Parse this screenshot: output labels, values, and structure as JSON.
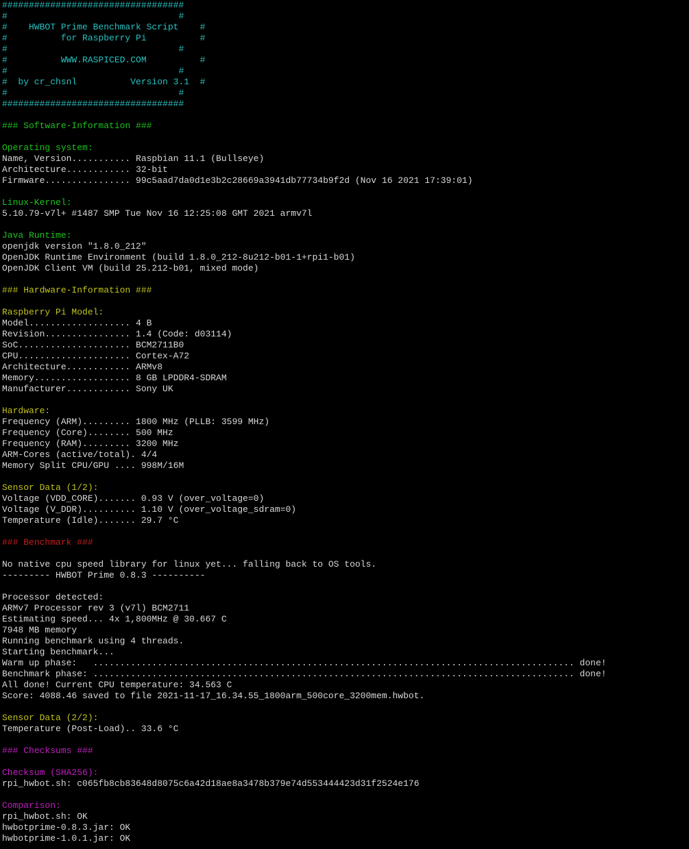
{
  "colors": {
    "background": "#000000",
    "white": "#d8d8d8",
    "cyan": "#29c1c1",
    "green": "#1ec21e",
    "yellow": "#c2c21e",
    "red": "#c41e1e",
    "magenta": "#c21ec2"
  },
  "lines": [
    {
      "text": "##################################",
      "color": "cyan"
    },
    {
      "text": "#                                #",
      "color": "cyan"
    },
    {
      "text": "#    HWBOT Prime Benchmark Script    #",
      "color": "cyan"
    },
    {
      "text": "#          for Raspberry Pi          #",
      "color": "cyan"
    },
    {
      "text": "#                                #",
      "color": "cyan"
    },
    {
      "text": "#          WWW.RASPICED.COM          #",
      "color": "cyan"
    },
    {
      "text": "#                                #",
      "color": "cyan"
    },
    {
      "text": "#  by cr_chsnl          Version 3.1  #",
      "color": "cyan"
    },
    {
      "text": "#                                #",
      "color": "cyan"
    },
    {
      "text": "##################################",
      "color": "cyan"
    },
    {
      "text": "",
      "color": "white"
    },
    {
      "text": "### Software-Information ###",
      "color": "green"
    },
    {
      "text": "",
      "color": "white"
    },
    {
      "text": "Operating system:",
      "color": "green"
    },
    {
      "text": "Name, Version........... Raspbian 11.1 (Bullseye)",
      "color": "white"
    },
    {
      "text": "Architecture............ 32-bit",
      "color": "white"
    },
    {
      "text": "Firmware................ 99c5aad7da0d1e3b2c28669a3941db77734b9f2d (Nov 16 2021 17:39:01)",
      "color": "white"
    },
    {
      "text": "",
      "color": "white"
    },
    {
      "text": "Linux-Kernel:",
      "color": "green"
    },
    {
      "text": "5.10.79-v7l+ #1487 SMP Tue Nov 16 12:25:08 GMT 2021 armv7l",
      "color": "white"
    },
    {
      "text": "",
      "color": "white"
    },
    {
      "text": "Java Runtime:",
      "color": "green"
    },
    {
      "text": "openjdk version \"1.8.0_212\"",
      "color": "white"
    },
    {
      "text": "OpenJDK Runtime Environment (build 1.8.0_212-8u212-b01-1+rpi1-b01)",
      "color": "white"
    },
    {
      "text": "OpenJDK Client VM (build 25.212-b01, mixed mode)",
      "color": "white"
    },
    {
      "text": "",
      "color": "white"
    },
    {
      "text": "### Hardware-Information ###",
      "color": "yellow"
    },
    {
      "text": "",
      "color": "white"
    },
    {
      "text": "Raspberry Pi Model:",
      "color": "yellow"
    },
    {
      "text": "Model................... 4 B",
      "color": "white"
    },
    {
      "text": "Revision................ 1.4 (Code: d03114)",
      "color": "white"
    },
    {
      "text": "SoC..................... BCM2711B0",
      "color": "white"
    },
    {
      "text": "CPU..................... Cortex-A72",
      "color": "white"
    },
    {
      "text": "Architecture............ ARMv8",
      "color": "white"
    },
    {
      "text": "Memory.................. 8 GB LPDDR4-SDRAM",
      "color": "white"
    },
    {
      "text": "Manufacturer............ Sony UK",
      "color": "white"
    },
    {
      "text": "",
      "color": "white"
    },
    {
      "text": "Hardware:",
      "color": "yellow"
    },
    {
      "text": "Frequency (ARM)......... 1800 MHz (PLLB: 3599 MHz)",
      "color": "white"
    },
    {
      "text": "Frequency (Core)........ 500 MHz",
      "color": "white"
    },
    {
      "text": "Frequency (RAM)......... 3200 MHz",
      "color": "white"
    },
    {
      "text": "ARM-Cores (active/total). 4/4",
      "color": "white"
    },
    {
      "text": "Memory Split CPU/GPU .... 998M/16M",
      "color": "white"
    },
    {
      "text": "",
      "color": "white"
    },
    {
      "text": "Sensor Data (1/2):",
      "color": "yellow"
    },
    {
      "text": "Voltage (VDD_CORE)....... 0.93 V (over_voltage=0)",
      "color": "white"
    },
    {
      "text": "Voltage (V_DDR).......... 1.10 V (over_voltage_sdram=0)",
      "color": "white"
    },
    {
      "text": "Temperature (Idle)....... 29.7 °C",
      "color": "white"
    },
    {
      "text": "",
      "color": "white"
    },
    {
      "text": "### Benchmark ###",
      "color": "red"
    },
    {
      "text": "",
      "color": "white"
    },
    {
      "text": "No native cpu speed library for linux yet... falling back to OS tools.",
      "color": "white"
    },
    {
      "text": "--------- HWBOT Prime 0.8.3 ----------",
      "color": "white"
    },
    {
      "text": "",
      "color": "white"
    },
    {
      "text": "Processor detected:",
      "color": "white"
    },
    {
      "text": "ARMv7 Processor rev 3 (v7l) BCM2711",
      "color": "white"
    },
    {
      "text": "Estimating speed... 4x 1,800MHz @ 30.667 C",
      "color": "white"
    },
    {
      "text": "7948 MB memory",
      "color": "white"
    },
    {
      "text": "Running benchmark using 4 threads.",
      "color": "white"
    },
    {
      "text": "Starting benchmark...",
      "color": "white"
    },
    {
      "text": "Warm up phase:   .......................................................................................... done!",
      "color": "white"
    },
    {
      "text": "Benchmark phase: .......................................................................................... done!",
      "color": "white"
    },
    {
      "text": "All done! Current CPU temperature: 34.563 C",
      "color": "white"
    },
    {
      "text": "Score: 4088.46 saved to file 2021-11-17_16.34.55_1800arm_500core_3200mem.hwbot.",
      "color": "white"
    },
    {
      "text": "",
      "color": "white"
    },
    {
      "text": "Sensor Data (2/2):",
      "color": "yellow"
    },
    {
      "text": "Temperature (Post-Load).. 33.6 °C",
      "color": "white"
    },
    {
      "text": "",
      "color": "white"
    },
    {
      "text": "### Checksums ###",
      "color": "magenta"
    },
    {
      "text": "",
      "color": "white"
    },
    {
      "text": "Checksum (SHA256):",
      "color": "magenta"
    },
    {
      "text": "rpi_hwbot.sh: c065fb8cb83648d8075c6a42d18ae8a3478b379e74d553444423d31f2524e176",
      "color": "white"
    },
    {
      "text": "",
      "color": "white"
    },
    {
      "text": "Comparison:",
      "color": "magenta"
    },
    {
      "text": "rpi_hwbot.sh: OK",
      "color": "white"
    },
    {
      "text": "hwbotprime-0.8.3.jar: OK",
      "color": "white"
    },
    {
      "text": "hwbotprime-1.0.1.jar: OK",
      "color": "white"
    }
  ]
}
